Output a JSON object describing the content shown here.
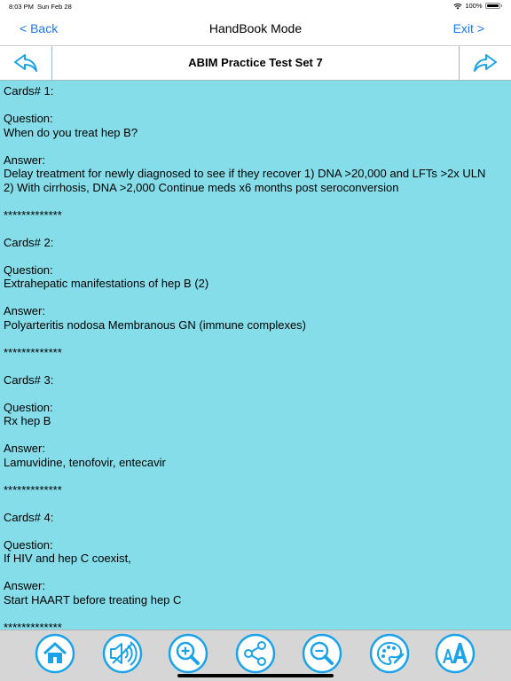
{
  "status": {
    "time": "8:03 PM",
    "date": "Sun Feb 28",
    "battery": "100%"
  },
  "nav": {
    "back_label": "<  Back",
    "title": "HandBook Mode",
    "exit_label": "Exit >"
  },
  "header": {
    "set_title": "ABIM Practice Test Set 7"
  },
  "cards": [
    {
      "heading": "Cards# 1:",
      "question_label": "Question:",
      "question": "When do you treat hep B?",
      "answer_label": "Answer:",
      "answer_lines": [
        "Delay treatment for newly diagnosed to see if they recover 1) DNA >20,000 and LFTs >2x ULN",
        "2) With cirrhosis, DNA >2,000 Continue meds x6 months post seroconversion"
      ],
      "separator": "*************"
    },
    {
      "heading": "Cards# 2:",
      "question_label": "Question:",
      "question": "Extrahepatic manifestations of hep B (2)",
      "answer_label": "Answer:",
      "answer_lines": [
        "Polyarteritis nodosa Membranous GN (immune complexes)"
      ],
      "separator": "*************"
    },
    {
      "heading": "Cards# 3:",
      "question_label": "Question:",
      "question": "Rx hep B",
      "answer_label": "Answer:",
      "answer_lines": [
        "Lamuvidine, tenofovir, entecavir"
      ],
      "separator": "*************"
    },
    {
      "heading": "Cards# 4:",
      "question_label": "Question:",
      "question": "If HIV and hep C coexist,",
      "answer_label": "Answer:",
      "answer_lines": [
        "Start HAART before treating hep C"
      ],
      "separator": "*************"
    }
  ],
  "colors": {
    "accent": "#1a78f2",
    "content_bg": "#85dde9",
    "icon_blue": "#1aa3e8",
    "toolbar_bg": "#d6d6d6"
  },
  "toolbar_icons": [
    "home-icon",
    "speaker-icon",
    "zoom-in-icon",
    "share-icon",
    "zoom-out-icon",
    "palette-icon",
    "font-icon"
  ]
}
